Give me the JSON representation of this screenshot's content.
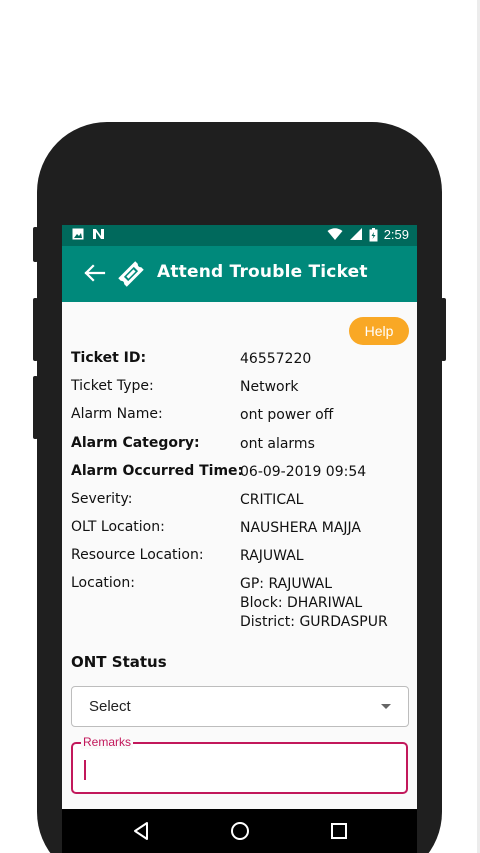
{
  "status_bar": {
    "time": "2:59",
    "left_icons": [
      "image-notification-icon",
      "n-notification-icon"
    ],
    "right_icons": [
      "wifi-icon",
      "signal-icon",
      "battery-icon"
    ]
  },
  "app_bar": {
    "title": "Attend Trouble Ticket",
    "color": "#00897b",
    "status_color": "#00695c"
  },
  "help_label": "Help",
  "details": [
    {
      "label": "Ticket ID:",
      "value": "46557220",
      "bold": true
    },
    {
      "label": "Ticket Type:",
      "value": "Network",
      "bold": false
    },
    {
      "label": "Alarm Name:",
      "value": "ont power off",
      "bold": false
    },
    {
      "label": "Alarm Category:",
      "value": "ont alarms",
      "bold": true
    },
    {
      "label": "Alarm Occurred Time:",
      "value": "06-09-2019 09:54",
      "bold": true
    },
    {
      "label": "Severity:",
      "value": "CRITICAL",
      "bold": false
    },
    {
      "label": "OLT Location:",
      "value": "NAUSHERA MAJJA",
      "bold": false
    },
    {
      "label": "Resource Location:",
      "value": "RAJUWAL",
      "bold": false
    },
    {
      "label": "Location:",
      "value_lines": [
        "GP: RAJUWAL",
        "Block: DHARIWAL",
        "District: GURDASPUR"
      ],
      "bold": false
    }
  ],
  "ont_status": {
    "title": "ONT Status",
    "selected": "Select"
  },
  "remarks": {
    "label": "Remarks",
    "value": "",
    "accent": "#c2185b"
  },
  "nav": [
    "back-nav-icon",
    "home-nav-icon",
    "recents-nav-icon"
  ],
  "colors": {
    "help": "#f9a825"
  }
}
